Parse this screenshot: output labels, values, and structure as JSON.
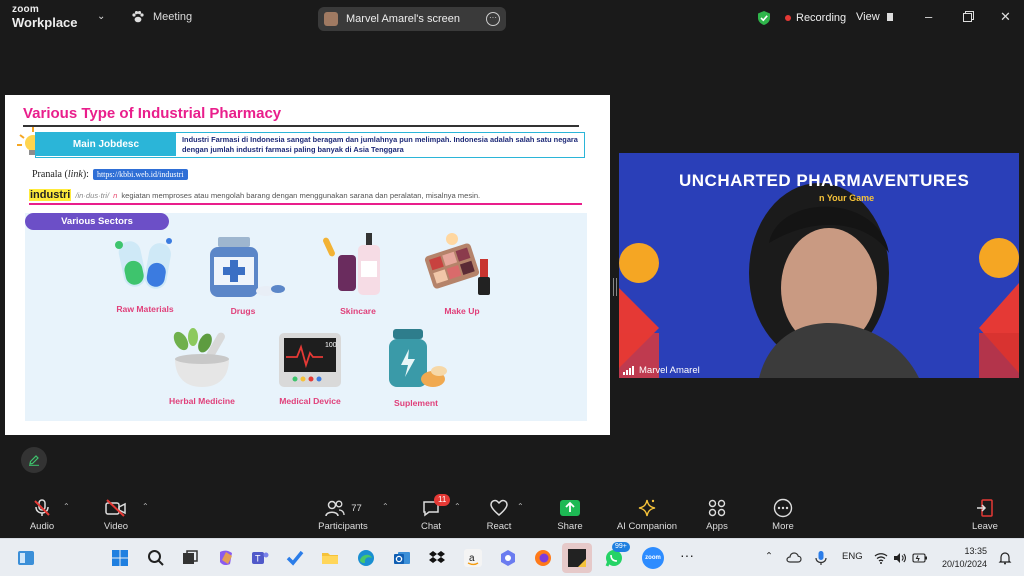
{
  "titlebar": {
    "brand_top": "zoom",
    "brand_bottom": "Workplace",
    "meeting_label": "Meeting",
    "screen_share_label": "Marvel Amarel's screen",
    "recording_label": "Recording",
    "view_label": "View"
  },
  "slide": {
    "title": "Various Type of Industrial Pharmacy",
    "jobdesc_label": "Main Jobdesc",
    "jobdesc_text": "Industri Farmasi di Indonesia sangat beragam dan jumlahnya pun melimpah. Indonesia adalah salah satu negara dengan jumlah industri farmasi paling banyak di Asia Tenggara",
    "pranala_prefix": "Pranala (",
    "pranala_link_word": "link",
    "pranala_suffix": "):",
    "pranala_url": "https://kbbi.web.id/industri",
    "def_word": "industri",
    "def_pron": "/in·dus·tri/",
    "def_pos": "n",
    "def_text": "kegiatan memproses atau mengolah barang dengan menggunakan sarana dan peralatan, misalnya mesin.",
    "sectors_label": "Various Sectors",
    "sectors": [
      "Raw Materials",
      "Drugs",
      "Skincare",
      "Make Up",
      "Herbal Medicine",
      "Medical Device",
      "Suplement"
    ],
    "monitor_reading": "100"
  },
  "video": {
    "heading": "UNCHARTED PHARMAVENTURES",
    "sub": "n Your Game",
    "participant_name": "Marvel Amarel"
  },
  "toolbar": {
    "audio": "Audio",
    "video": "Video",
    "participants": "Participants",
    "participants_count": "77",
    "chat": "Chat",
    "chat_badge": "11",
    "react": "React",
    "share": "Share",
    "ai_companion": "AI Companion",
    "apps": "Apps",
    "more": "More",
    "leave": "Leave"
  },
  "taskbar": {
    "lang": "ENG",
    "time": "13:35",
    "date": "20/10/2024",
    "whatsapp_badge": "99+",
    "zoom_icon_text": "zoom"
  },
  "colors": {
    "accent_pink": "#e91e8c",
    "jobdesc_blue": "#2bb5d8",
    "sectors_purple": "#6c4fc7",
    "share_green": "#1db954",
    "recording_red": "#e53935"
  }
}
